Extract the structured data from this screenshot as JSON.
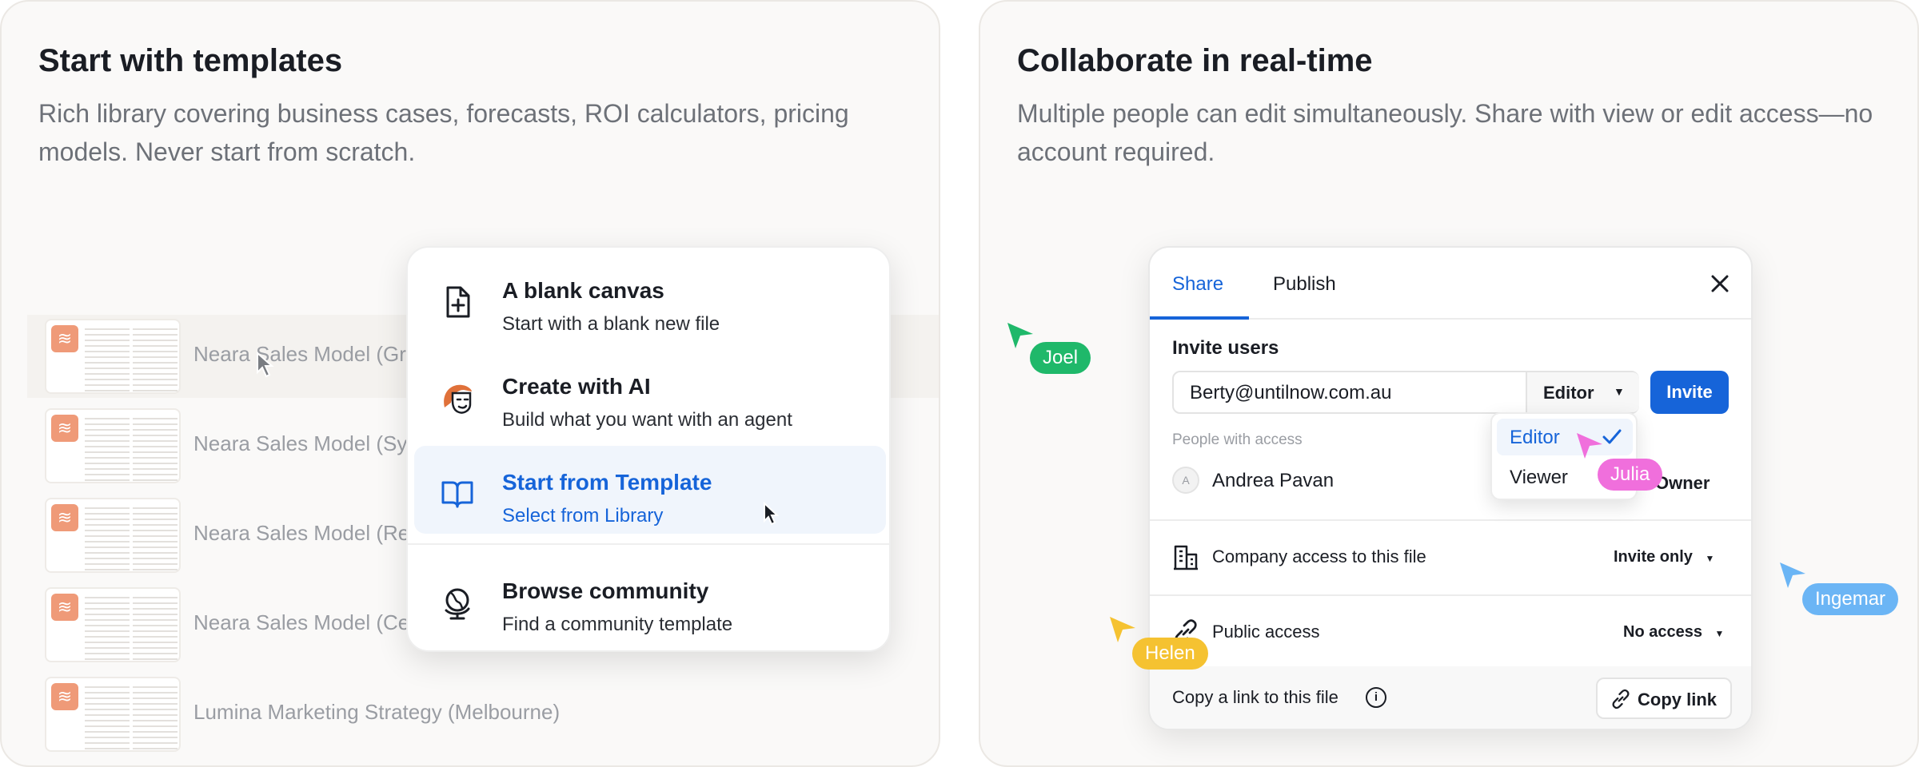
{
  "left_card": {
    "title": "Start with templates",
    "description": "Rich library covering business cases, forecasts, ROI calculators, pricing models. Never start from scratch.",
    "files": [
      {
        "name": "Neara Sales Model (Gre"
      },
      {
        "name": "Neara Sales Model (Syd"
      },
      {
        "name": "Neara Sales Model (Reg"
      },
      {
        "name": "Neara Sales Model (Cen"
      },
      {
        "name": "Lumina Marketing Strategy (Melbourne)"
      }
    ],
    "menu": {
      "items": [
        {
          "title": "A blank canvas",
          "subtitle": "Start with a blank new file",
          "icon": "file-plus-icon"
        },
        {
          "title": "Create with AI",
          "subtitle": "Build what you want with an agent",
          "icon": "ai-agent-icon"
        },
        {
          "title": "Start from Template",
          "subtitle": "Select from Library",
          "icon": "book-icon"
        },
        {
          "title": "Browse community",
          "subtitle": "Find a community template",
          "icon": "globe-icon"
        }
      ]
    }
  },
  "right_card": {
    "title": "Collaborate in real-time",
    "description": "Multiple people can edit simultaneously. Share with view or edit access—no account required.",
    "dialog": {
      "tabs": [
        "Share",
        "Publish"
      ],
      "close_icon": "close-icon",
      "invite_label": "Invite users",
      "email_value": "Berty@untilnow.com.au",
      "role_selected": "Editor",
      "invite_button": "Invite",
      "people_label": "People with access",
      "person": {
        "initial": "A",
        "name": "Andrea Pavan",
        "role": "Owner"
      },
      "company_access_label": "Company access to this file",
      "company_access_value": "Invite only",
      "public_access_label": "Public access",
      "public_access_value": "No access",
      "footer_text": "Copy a link to this file",
      "copy_button": "Copy link"
    },
    "role_dropdown": {
      "options": [
        "Editor",
        "Viewer"
      ],
      "selected": "Editor"
    },
    "collaborators": [
      {
        "name": "Joel",
        "color": "#1fb86a"
      },
      {
        "name": "Julia",
        "color": "#f06fdc"
      },
      {
        "name": "Ingemar",
        "color": "#6bb5f5"
      },
      {
        "name": "Helen",
        "color": "#f5c231"
      }
    ]
  },
  "colors": {
    "accent": "#1664d9",
    "thumbnail_icon": "#ef9a78"
  }
}
